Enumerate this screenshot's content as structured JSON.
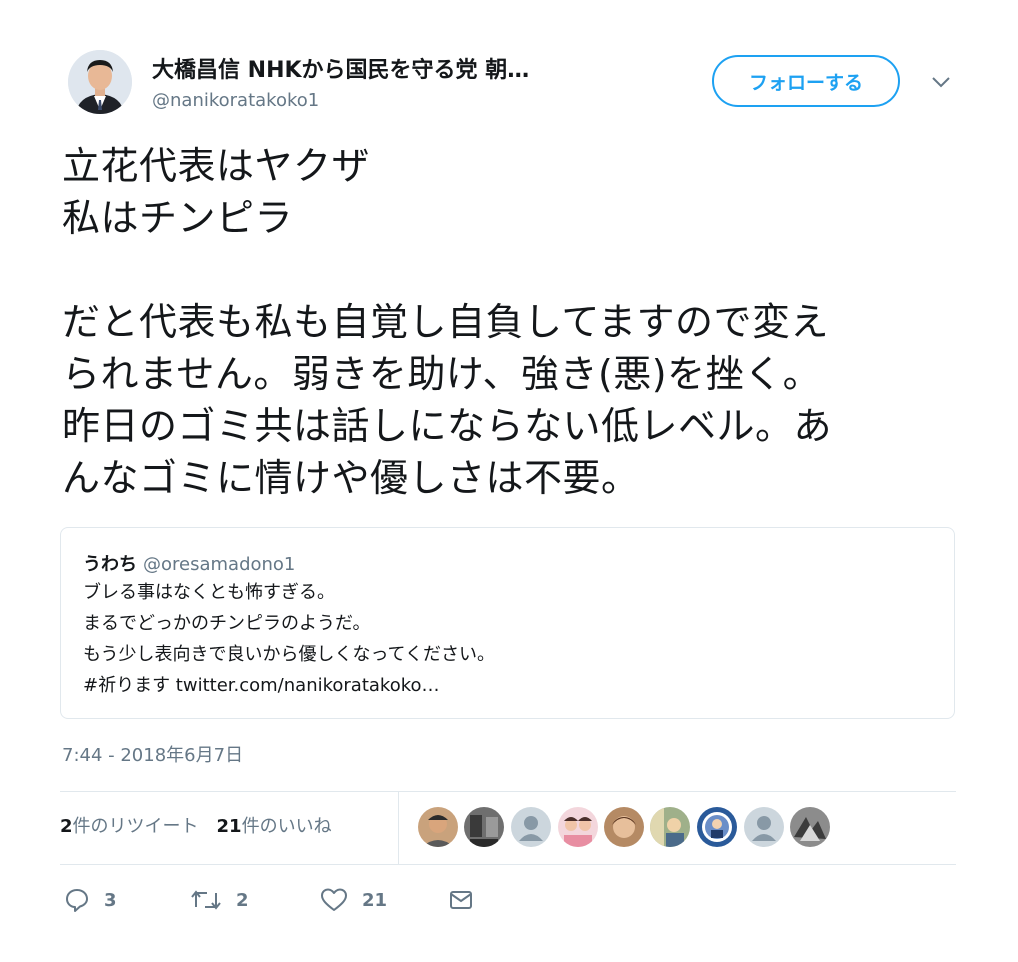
{
  "author": {
    "name": "大橋昌信 NHKから国民を守る党 朝…",
    "handle": "@nanikoratakoko1"
  },
  "follow_button": "フォローする",
  "tweet_text": "立花代表はヤクザ\n私はチンピラ\n\nだと代表も私も自覚し自負してますので変え\nられません。弱きを助け、強き(悪)を挫く。\n昨日のゴミ共は話しにならない低レベル。あ\nんなゴミに情けや優しさは不要。",
  "quoted_tweet": {
    "name": "うわち",
    "handle": "@oresamadono1",
    "lines": [
      "ブレる事はなくとも怖すぎる。",
      "まるでどっかのチンピラのようだ。",
      "もう少し表向きで良いから優しくなってください。",
      "#祈ります twitter.com/nanikoratakoko…"
    ]
  },
  "timestamp": "7:44 - 2018年6月7日",
  "stats": {
    "retweets_count": "2",
    "retweets_label": "件のリツイート",
    "likes_count": "21",
    "likes_label": "件のいいね"
  },
  "actions": {
    "reply_count": "3",
    "retweet_count": "2",
    "like_count": "21"
  },
  "icons": [
    "caret-down-icon",
    "reply-icon",
    "retweet-icon",
    "heart-icon",
    "mail-icon"
  ],
  "colors": {
    "accent": "#1da1f2",
    "secondary_text": "#657786",
    "border": "#e1e8ed"
  }
}
